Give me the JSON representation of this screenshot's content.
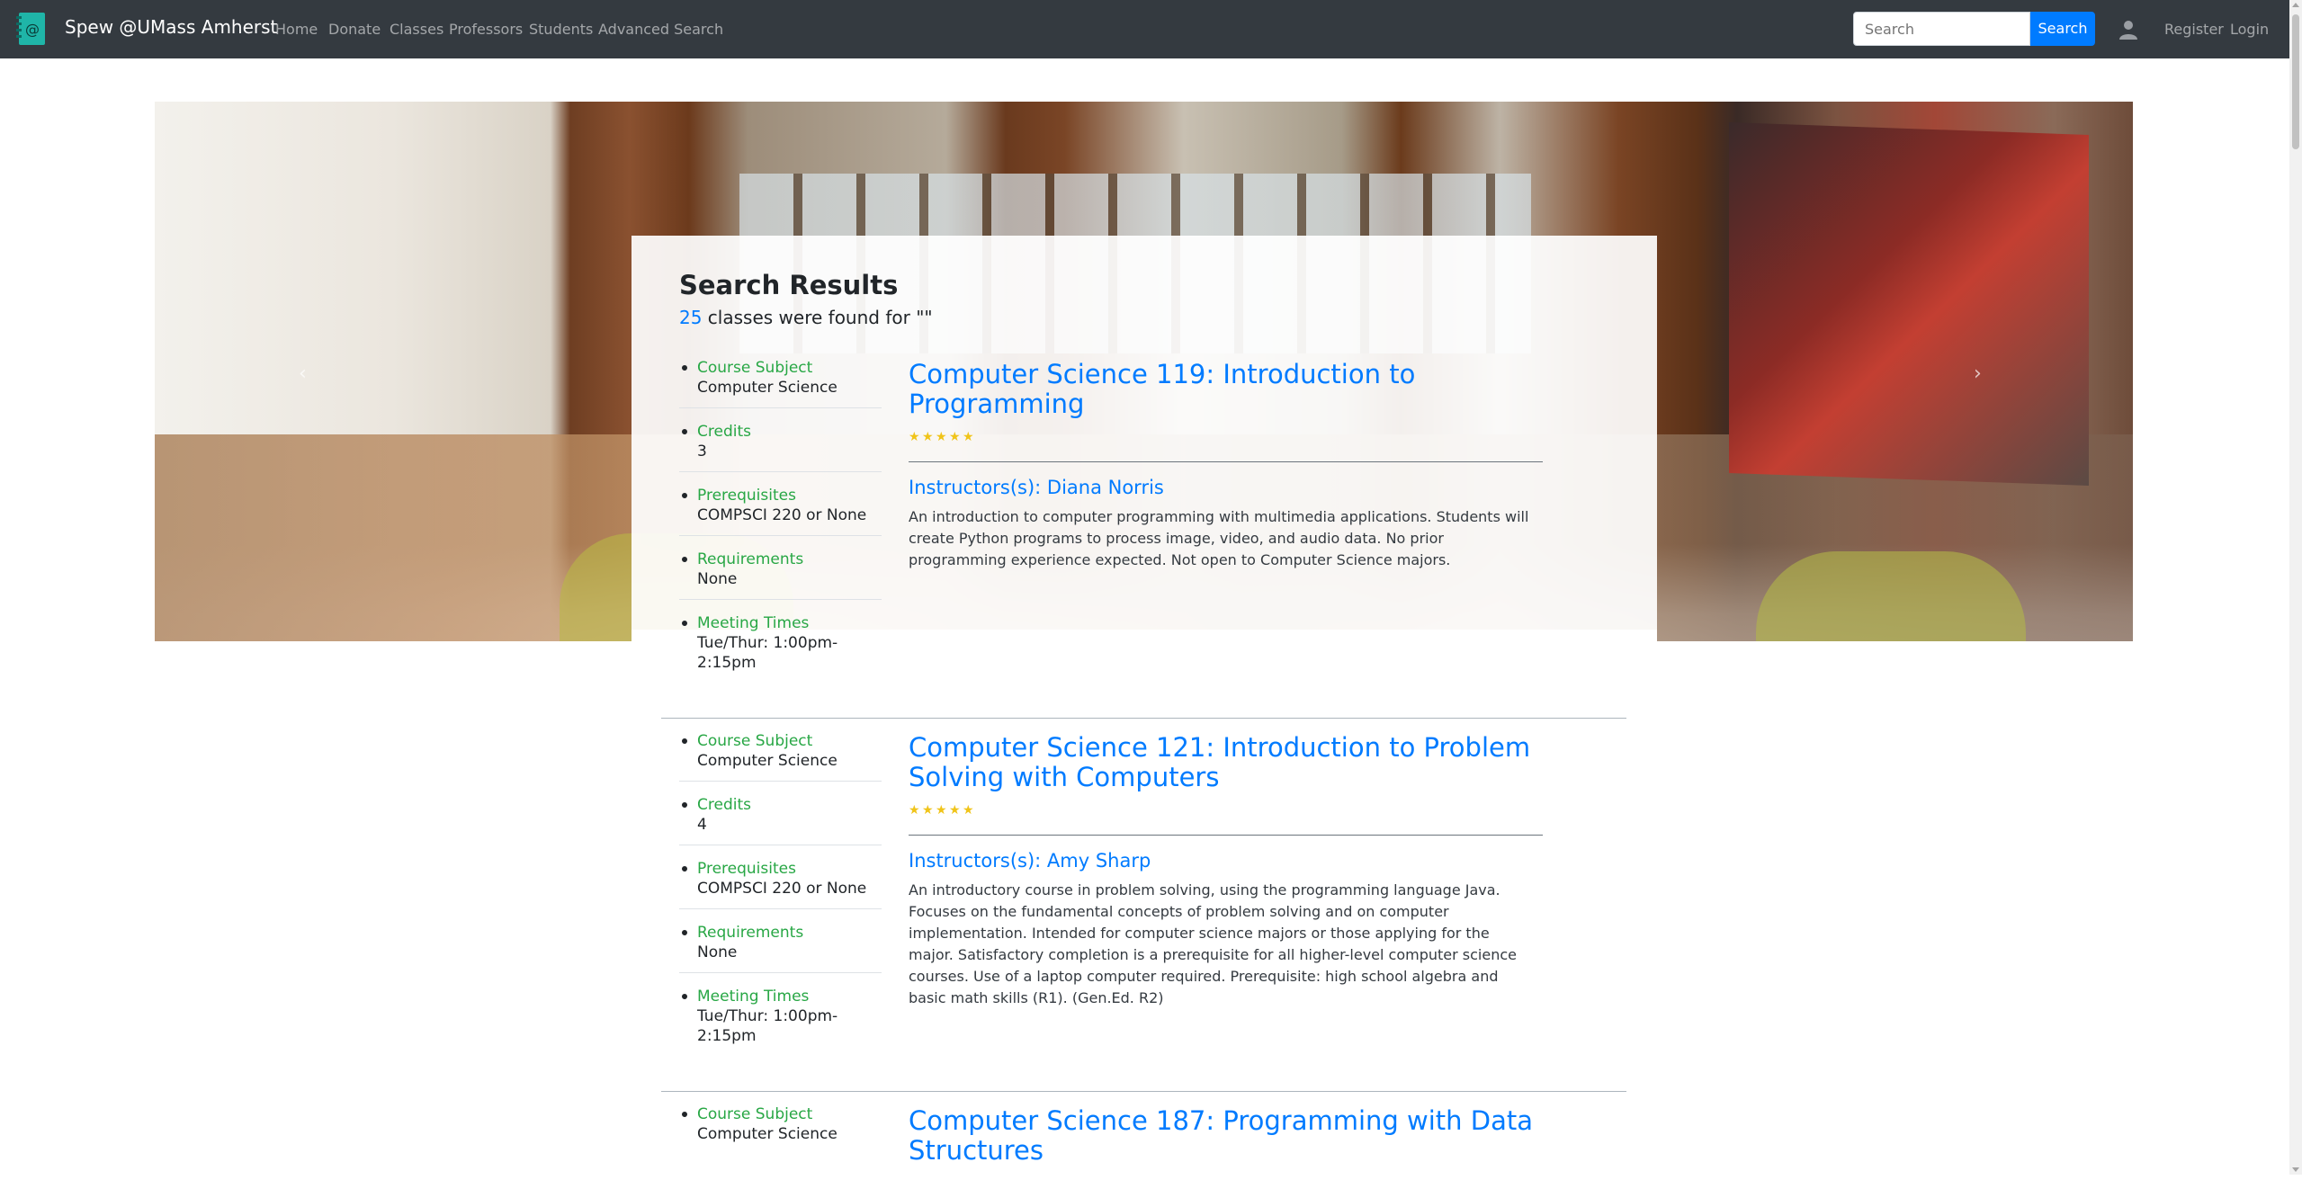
{
  "navbar": {
    "brand": "Spew @UMass Amherst",
    "links": [
      "Home",
      "Donate",
      "Classes",
      "Professors",
      "Students",
      "Advanced Search"
    ],
    "search_placeholder": "Search",
    "search_button": "Search",
    "register": "Register",
    "login": "Login"
  },
  "results": {
    "title": "Search Results",
    "count": "25",
    "count_text": " classes were found for \"\""
  },
  "labels": {
    "course_subject": "Course Subject",
    "credits": "Credits",
    "prerequisites": "Prerequisites",
    "requirements": "Requirements",
    "meeting_times": "Meeting Times",
    "instructors_prefix": "Instructors(s): "
  },
  "classes": [
    {
      "title": "Computer Science 119: Introduction to Programming",
      "rating": 5,
      "subject": "Computer Science",
      "credits": "3",
      "prerequisites": "COMPSCI 220 or None",
      "requirements": "None",
      "meeting_times": "Tue/Thur: 1:00pm-2:15pm",
      "instructors": "Instructors(s): Diana Norris",
      "description": "An introduction to computer programming with multimedia applications. Students will create Python programs to process image, video, and audio data. No prior programming experience expected. Not open to Computer Science majors."
    },
    {
      "title": "Computer Science 121: Introduction to Problem Solving with Computers",
      "rating": 5,
      "subject": "Computer Science",
      "credits": "4",
      "prerequisites": "COMPSCI 220 or None",
      "requirements": "None",
      "meeting_times": "Tue/Thur: 1:00pm-2:15pm",
      "instructors": "Instructors(s): Amy Sharp",
      "description": "An introductory course in problem solving, using the programming language Java. Focuses on the fundamental concepts of problem solving and on computer implementation. Intended for computer science majors or those applying for the major. Satisfactory completion is a prerequisite for all higher-level computer science courses. Use of a laptop computer required. Prerequisite: high school algebra and basic math skills (R1). (Gen.Ed. R2)"
    },
    {
      "title": "Computer Science 187: Programming with Data Structures",
      "subject": "Computer Science"
    }
  ],
  "colors": {
    "navbar_bg": "#343a40",
    "link_blue": "#007bff",
    "label_green": "#28a745",
    "star_gold": "#f0c419"
  }
}
